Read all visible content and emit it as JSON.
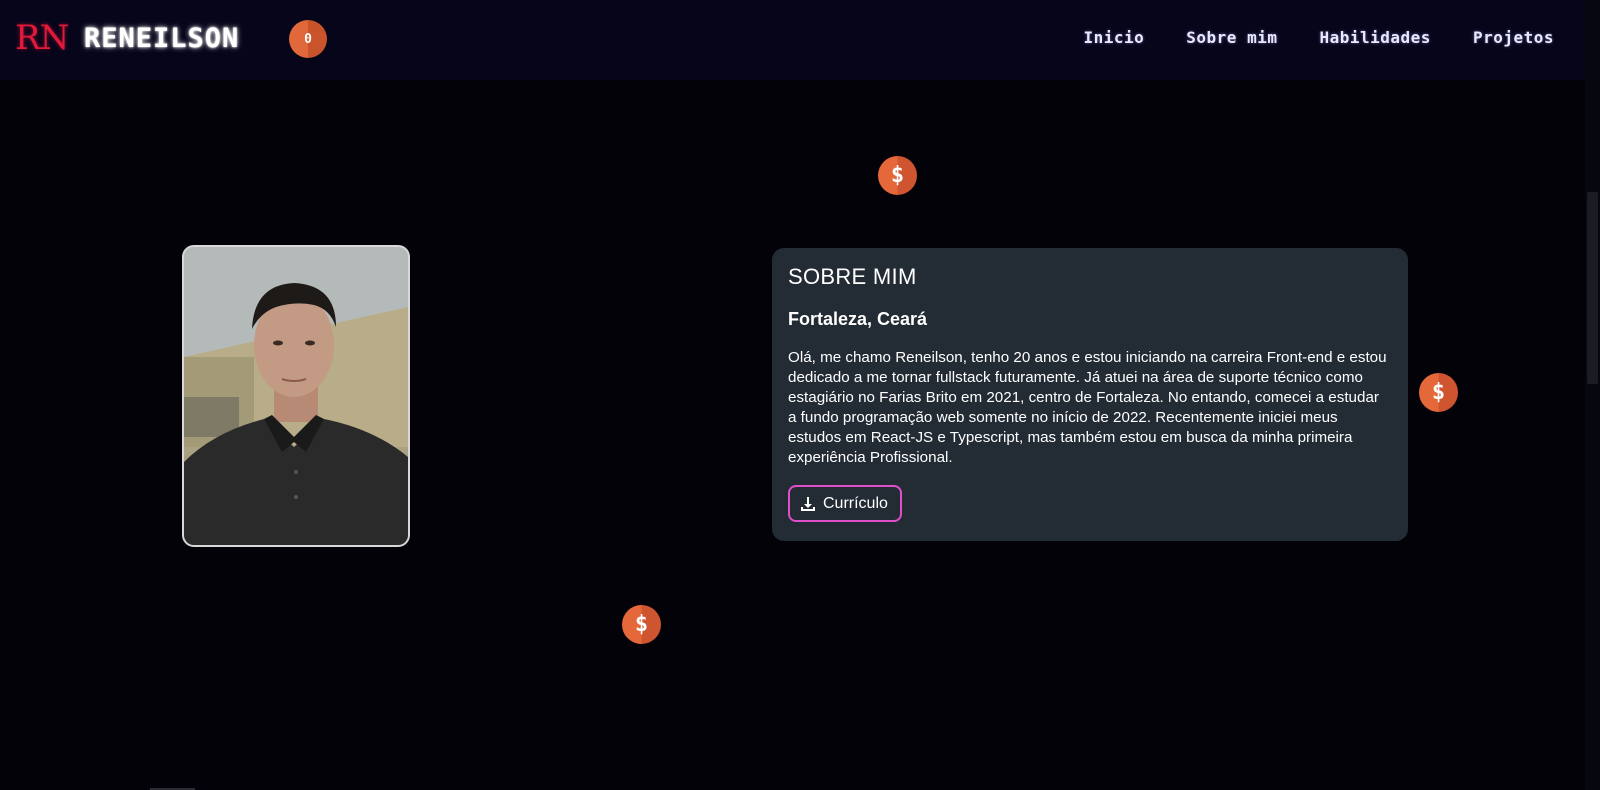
{
  "header": {
    "logo_mark": "RN",
    "logo_name": "RENEILSON",
    "coin_count": "0",
    "nav": [
      {
        "label": "Inicio"
      },
      {
        "label": "Sobre mim"
      },
      {
        "label": "Habilidades"
      },
      {
        "label": "Projetos"
      }
    ]
  },
  "about": {
    "title": "SOBRE MIM",
    "location": "Fortaleza, Ceará",
    "text": "Olá, me chamo Reneilson, tenho 20 anos e estou iniciando na carreira Front-end e estou dedicado a me tornar fullstack futuramente. Já atuei na área de suporte técnico como estagiário no Farias Brito em 2021, centro de Fortaleza. No entando, comecei a estudar a fundo programação web somente no início de 2022. Recentemente iniciei meus estudos em React-JS e Typescript, mas também estou em busca da minha primeira experiência Profissional.",
    "cv_label": "Currículo",
    "cv_icon": "download-icon"
  },
  "coins": {
    "symbol": "$",
    "icon": "coin-icon"
  },
  "colors": {
    "background": "#030208",
    "header": "#06051a",
    "card": "#232b35",
    "logo_red": "#e3193b",
    "coin_orange": "#e5683b",
    "button_border": "#e04ec9"
  }
}
